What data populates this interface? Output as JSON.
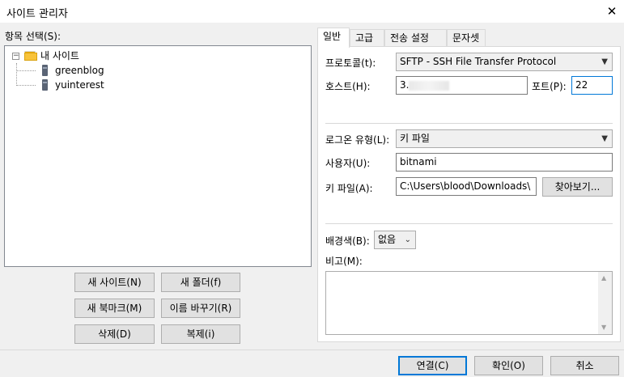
{
  "window": {
    "title": "사이트 관리자",
    "close_glyph": "✕"
  },
  "tree": {
    "label": "항목 선택(S):",
    "root": {
      "label": "내 사이트",
      "expander": "−"
    },
    "sites": [
      {
        "label": "greenblog"
      },
      {
        "label": "yuinterest"
      }
    ]
  },
  "left_buttons": {
    "new_site": "새 사이트(N)",
    "new_folder": "새 폴더(f)",
    "new_bookmark": "새 북마크(M)",
    "rename": "이름 바꾸기(R)",
    "delete": "삭제(D)",
    "duplicate": "복제(i)"
  },
  "tabs": [
    "일반",
    "고급",
    "전송 설정",
    "문자셋"
  ],
  "general": {
    "protocol_label": "프로토콜(t):",
    "protocol_value": "SFTP - SSH File Transfer Protocol",
    "host_label": "호스트(H):",
    "host_value": "3.",
    "port_label": "포트(P):",
    "port_value": "22",
    "logon_type_label": "로그온 유형(L):",
    "logon_type_value": "키 파일",
    "user_label": "사용자(U):",
    "user_value": "bitnami",
    "keyfile_label": "키 파일(A):",
    "keyfile_value": "C:\\Users\\blood\\Downloads\\",
    "browse_button": "찾아보기...",
    "bgcolor_label": "배경색(B):",
    "bgcolor_value": "없음",
    "comments_label": "비고(M):",
    "comments_value": ""
  },
  "footer_buttons": {
    "connect": "연결(C)",
    "ok": "확인(O)",
    "cancel": "취소"
  }
}
